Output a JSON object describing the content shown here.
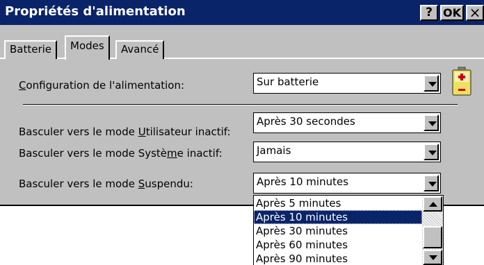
{
  "window": {
    "title": "Propriétés d'alimentation",
    "help_label": "?",
    "ok_label": "OK",
    "close_label": "×"
  },
  "tabs": [
    {
      "label": "Batterie",
      "active": false
    },
    {
      "label": "Modes",
      "active": true
    },
    {
      "label": "Avancé",
      "active": false
    }
  ],
  "power_config": {
    "label_pre": "",
    "label_u": "C",
    "label_post": "onfiguration de l'alimentation:",
    "value": "Sur batterie",
    "icon": "battery-icon"
  },
  "user_idle": {
    "label_pre": "Basculer vers le mode ",
    "label_u": "U",
    "label_post": "tilisateur inactif:",
    "value": "Après 30 secondes"
  },
  "system_idle": {
    "label_pre": "Basculer vers le mode Systè",
    "label_u": "m",
    "label_post": "e inactif:",
    "value": "Jamais"
  },
  "suspend": {
    "label_pre": "Basculer vers le mode ",
    "label_u": "S",
    "label_post": "uspendu:",
    "value": "Après 10 minutes",
    "options": [
      "Après 5 minutes",
      "Après 10 minutes",
      "Après 30 minutes",
      "Après 60 minutes",
      "Après 90 minutes"
    ],
    "selected_index": 1
  },
  "colors": {
    "titlebar": "#0a246a",
    "face": "#c0c0c0",
    "selection": "#0a246a"
  }
}
